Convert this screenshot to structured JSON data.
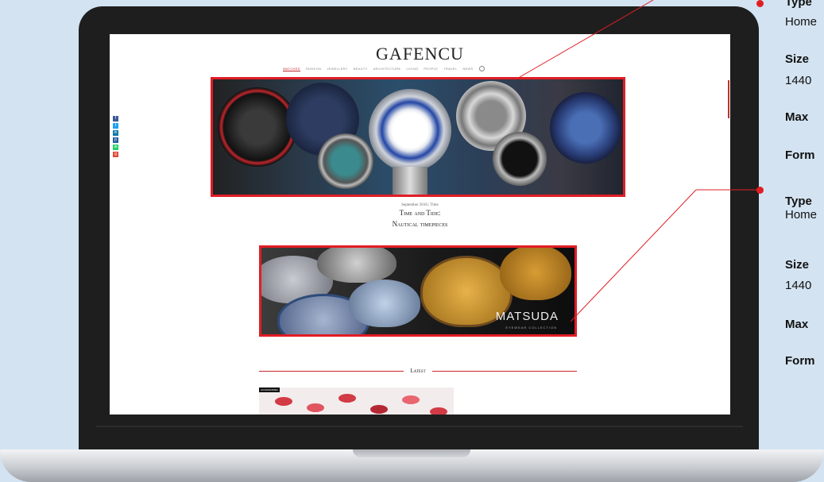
{
  "site": {
    "logo": "GAFENCU",
    "nav": [
      "WATCHES",
      "FASHION",
      "JEWELLERY",
      "BEAUTY",
      "ARCHITECTURE",
      "LIVING",
      "PEOPLE",
      "TRAVEL",
      "NEWS"
    ],
    "social": [
      "f",
      "t",
      "in",
      "p",
      "w",
      "g"
    ]
  },
  "feature": {
    "date": "September 2016 | Time",
    "title_line1": "Time and Tide:",
    "title_line2": "Nautical timepieces"
  },
  "ad": {
    "brand": "MATSUDA",
    "brand_sub": "EYEWEAR COLLECTION"
  },
  "latest": {
    "label": "Latest",
    "tag": "ACCESSORIES"
  },
  "callouts": [
    {
      "text": "Type",
      "bold": true
    },
    {
      "text": "Home",
      "bold": false
    },
    {
      "text": "Size",
      "bold": true
    },
    {
      "text": "1440",
      "bold": false
    },
    {
      "text": "Max",
      "bold": true
    },
    {
      "text": "Form",
      "bold": true
    },
    {
      "text": "Type",
      "bold": true
    },
    {
      "text": "Home",
      "bold": false
    },
    {
      "text": "Size",
      "bold": true
    },
    {
      "text": "1440",
      "bold": false
    },
    {
      "text": "Max",
      "bold": true
    },
    {
      "text": "Form",
      "bold": true
    }
  ],
  "colors": {
    "accent": "#e11d24",
    "background": "#d3e3f1"
  }
}
